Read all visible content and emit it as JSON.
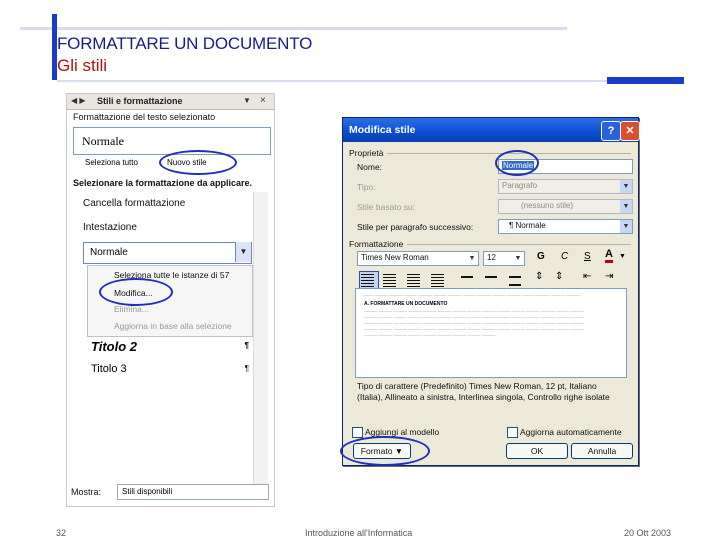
{
  "slide": {
    "title": "FORMATTARE UN DOCUMENTO",
    "subtitle": "Gli stili",
    "page_number": "32",
    "footer_center": "Introduzione all'Informatica",
    "footer_date": "20 Ott 2003",
    "colors": {
      "accent": "#1a3cc8",
      "subtitle": "#b01010",
      "title": "#1a1a8c"
    }
  },
  "taskpane": {
    "title": "Stili e formattazione",
    "section1_label": "Formattazione del testo selezionato",
    "current_style": "Normale",
    "select_all_label": "Seleziona tutto",
    "new_style_label": "Nuovo stile",
    "section2_label": "Selezionare la formattazione da applicare.",
    "styles": [
      "Cancella formattazione",
      "Intestazione",
      "Normale",
      "Titolo 2",
      "Titolo 3"
    ],
    "context_menu": [
      "Seleziona tutte le istanze di 57",
      "Modifica...",
      "Elimina...",
      "Aggiorna in base alla selezione"
    ],
    "show_label": "Mostra:",
    "show_value": "Stili disponibili"
  },
  "dialog": {
    "title": "Modifica stile",
    "help_label": "?",
    "close_label": "✕",
    "props_label": "Proprietà",
    "name_label": "Nome:",
    "name_value": "Normale",
    "type_label": "Tipo:",
    "type_value": "Paragrafo",
    "based_label": "Stile basato su:",
    "based_value": "(nessuno stile)",
    "next_label": "Stile per paragrafo successivo:",
    "next_value": "¶ Normale",
    "format_label": "Formattazione",
    "font_value": "Times New Roman",
    "size_value": "12",
    "bold_label": "G",
    "italic_label": "C",
    "underline_label": "S",
    "color_label": "A",
    "preview_bold": "A. FORMATTARE UN DOCUMENTO",
    "description": "Tipo di carattere (Predefinito) Times New Roman, 12 pt, Italiano (Italia), Allineato a sinistra, Interlinea singola, Controllo righe isolate",
    "add_template_label": "Aggiungi al modello",
    "auto_update_label": "Aggiorna automaticamente",
    "format_button": "Formato ▼",
    "ok_label": "OK",
    "cancel_label": "Annulla"
  },
  "icons": [
    "arrows-icon",
    "close-icon",
    "dropdown-icon",
    "paragraph-icon",
    "help-icon",
    "font-color-icon"
  ]
}
